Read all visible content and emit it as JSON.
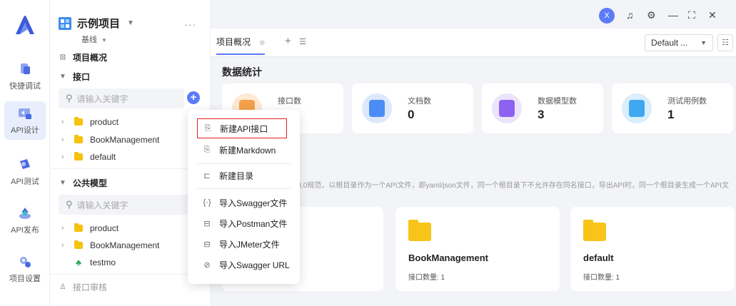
{
  "rail": {
    "items": [
      {
        "label": "快捷调试",
        "icon": "quick-debug-icon"
      },
      {
        "label": "API设计",
        "icon": "api-design-icon",
        "active": true
      },
      {
        "label": "API测试",
        "icon": "api-test-icon"
      },
      {
        "label": "API发布",
        "icon": "api-publish-icon"
      },
      {
        "label": "项目设置",
        "icon": "project-settings-icon"
      }
    ]
  },
  "project": {
    "name": "示例项目",
    "branch": "基线",
    "more": "···",
    "overview": "项目概况",
    "interfaces_section": "接口",
    "search_placeholder": "请输入关键字",
    "tree": [
      "product",
      "BookManagement",
      "default"
    ],
    "models_section": "公共模型",
    "model_search_placeholder": "请输入关键字",
    "models": [
      "product",
      "BookManagement",
      "testmo"
    ],
    "review": "接口审核"
  },
  "topbar": {
    "avatar": "X"
  },
  "tabs": {
    "active": "项目概况",
    "environment": "Default ..."
  },
  "content": {
    "section_title": "数据统计",
    "stats": [
      {
        "label": "接口数",
        "value": "",
        "color": "#fde9d4",
        "inner": "#f5a14a"
      },
      {
        "label": "文档数",
        "value": "0",
        "color": "#dde9fb",
        "inner": "#4a8ef5"
      },
      {
        "label": "数据模型数",
        "value": "3",
        "color": "#ece4fb",
        "inner": "#8e62f0"
      },
      {
        "label": "测试用例数",
        "value": "1",
        "color": "#daeefb",
        "inner": "#3fa8f0"
      }
    ],
    "description": "PI3.0规范，以根目录作为一个API文件，即yaml/json文件，同一个根目录下不允许存在同名接口，导出API时，同一个根目录生成一个API文",
    "folders": [
      {
        "title": "BookManagement",
        "sub": "接口数量: 1"
      },
      {
        "title": "default",
        "sub": "接口数量: 1"
      }
    ]
  },
  "menu": {
    "items": [
      {
        "label": "新建API接口",
        "icon": "new-api-icon",
        "highlight": true
      },
      {
        "label": "新建Markdown",
        "icon": "new-markdown-icon"
      },
      {
        "label": "新建目录",
        "icon": "new-folder-icon"
      },
      {
        "label": "导入Swagger文件",
        "icon": "import-swagger-icon"
      },
      {
        "label": "导入Postman文件",
        "icon": "import-postman-icon"
      },
      {
        "label": "导入JMeter文件",
        "icon": "import-jmeter-icon"
      },
      {
        "label": "导入Swagger URL",
        "icon": "import-url-icon"
      }
    ]
  }
}
